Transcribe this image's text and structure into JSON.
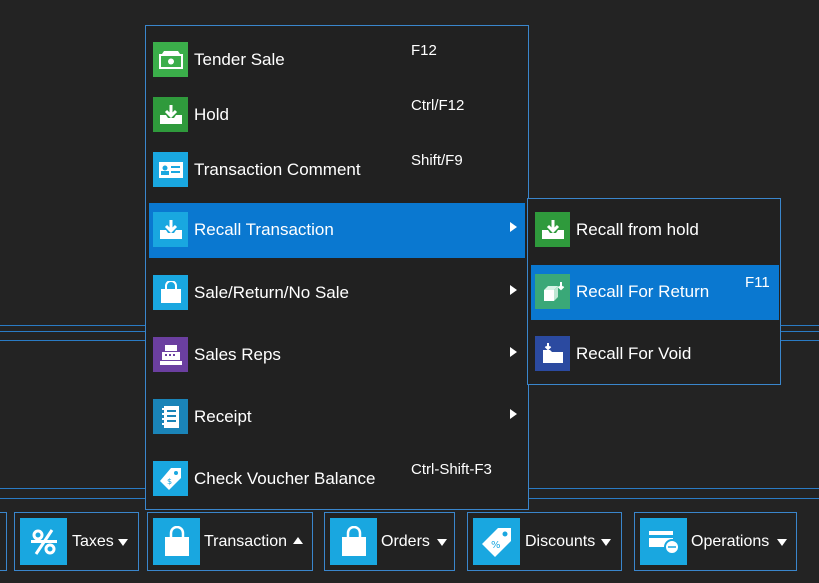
{
  "main_menu": {
    "items": [
      {
        "label": "Tender Sale",
        "shortcut": "F12",
        "icon": "cash-icon",
        "color": "#3bae4a"
      },
      {
        "label": "Hold",
        "shortcut": "Ctrl/F12",
        "icon": "tray-download-icon",
        "color": "#2f9a3c"
      },
      {
        "label": "Transaction Comment",
        "shortcut": "Shift/F9",
        "icon": "id-card-icon",
        "color": "#19a7e0"
      },
      {
        "label": "Recall Transaction",
        "shortcut": "",
        "icon": "tray-download-icon",
        "color": "#19a7e0"
      },
      {
        "label": "Sale/Return/No Sale",
        "shortcut": "",
        "icon": "shopping-bag-icon",
        "color": "#19a7e0"
      },
      {
        "label": "Sales Reps",
        "shortcut": "",
        "icon": "cash-register-icon",
        "color": "#6b3fa0"
      },
      {
        "label": "Receipt",
        "shortcut": "",
        "icon": "receipt-icon",
        "color": "#1a84b8"
      },
      {
        "label": "Check Voucher Balance",
        "shortcut": "Ctrl-Shift-F3",
        "icon": "voucher-tag-icon",
        "color": "#19a7e0"
      }
    ]
  },
  "sub_menu": {
    "items": [
      {
        "label": "Recall from hold",
        "shortcut": "",
        "icon": "tray-download-icon",
        "color": "#2f9a3c"
      },
      {
        "label": "Recall For Return",
        "shortcut": "F11",
        "icon": "box-return-icon",
        "color": "#3aa878"
      },
      {
        "label": "Recall For Void",
        "shortcut": "",
        "icon": "folder-download-icon",
        "color": "#2b4aa0"
      }
    ]
  },
  "toolbar": {
    "buttons": [
      {
        "label": "Taxes",
        "icon": "percent-icon"
      },
      {
        "label": "Transaction",
        "icon": "shopping-bag-icon"
      },
      {
        "label": "Orders",
        "icon": "shopping-bag-icon"
      },
      {
        "label": "Discounts",
        "icon": "discount-tag-icon"
      },
      {
        "label": "Operations",
        "icon": "card-coin-icon"
      }
    ]
  },
  "colors": {
    "accent": "#0a78d0",
    "border": "#3a86cc",
    "icon_bg": "#19a7e0",
    "background": "#232323"
  }
}
